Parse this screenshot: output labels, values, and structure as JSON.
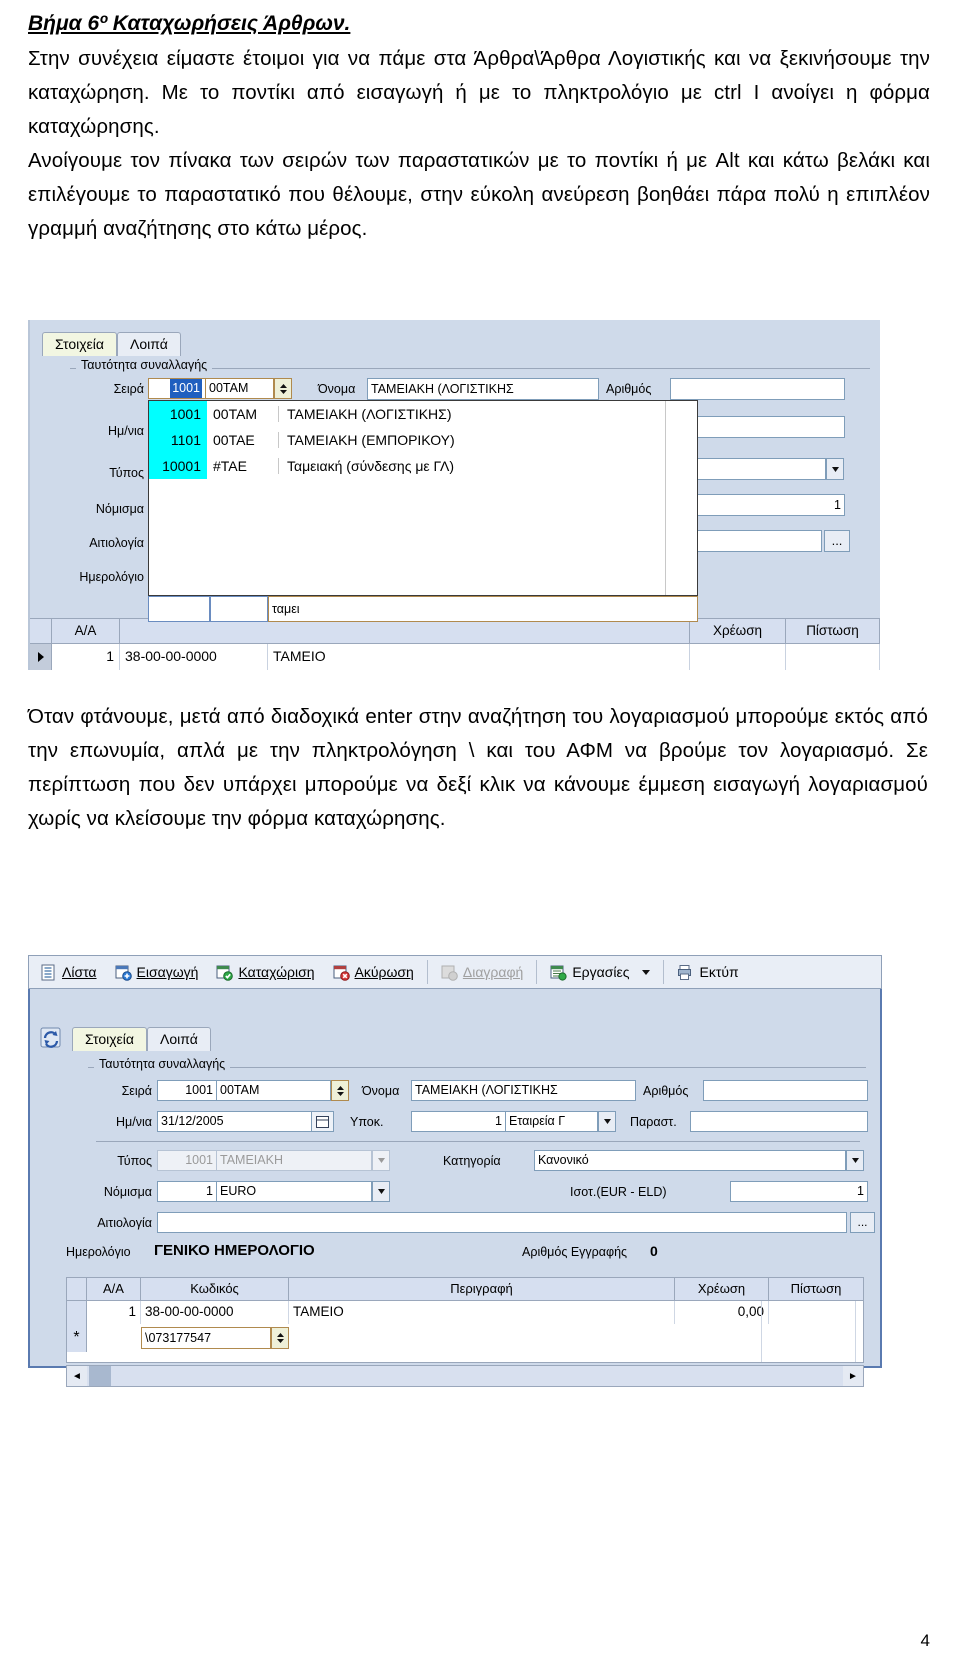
{
  "document": {
    "heading": "Βήμα 6º  Καταχωρήσεις Άρθρων.",
    "para1": "Στην συνέχεια είμαστε έτοιμοι για να πάμε στα Άρθρα\\Άρθρα Λογιστικής και να ξεκινήσουμε την καταχώρηση. Με το ποντίκι από εισαγωγή ή με το πληκτρολόγιο με ctrl I ανοίγει η φόρμα καταχώρησης.",
    "para2": "Ανοίγουμε τον πίνακα των σειρών των παραστατικών με το ποντίκι ή με Alt και κάτω βελάκι και επιλέγουμε το παραστατικό που θέλουμε, στην εύκολη ανεύρεση  βοηθάει πάρα πολύ η επιπλέον γραμμή αναζήτησης στο κάτω μέρος.",
    "para3": "Όταν φτάνουμε, μετά από διαδοχικά enter στην αναζήτηση του λογαριασμού μπορούμε εκτός από την επωνυμία, απλά με την πληκτρολόγηση \\ και του ΑΦΜ να βρούμε τον λογαριασμό. Σε περίπτωση που δεν υπάρχει μπορούμε να δεξί κλικ να κάνουμε έμμεση εισαγωγή λογαριασμού χωρίς να κλείσουμε την φόρμα καταχώρησης.",
    "page_number": "4"
  },
  "screenshot1": {
    "tabs": [
      {
        "label": "Στοιχεία",
        "active": true
      },
      {
        "label": "Λοιπά",
        "active": false
      }
    ],
    "group_title": "Ταυτότητα συναλλαγής",
    "labels": {
      "seira": "Σειρά",
      "onoma": "Όνομα",
      "arithmos": "Αριθμός",
      "imnia": "Ημ/νια",
      "typos": "Τύπος",
      "nomisma": "Νόμισμα",
      "aitiologia": "Αιτιολογία",
      "imerologio": "Ημερολόγιο"
    },
    "seira_code": "1001",
    "seira_abbr": "00TAM",
    "onoma_value": "ΤΑΜΕΙΑΚΗ (ΛΟΓΙΣΤΙΚΗΣ",
    "arithmos_value": "",
    "nomisma_rate": "1",
    "ellipsis_button": "...",
    "dropdown_items": [
      {
        "code": "1001",
        "abbr": "00TAM",
        "name": "ΤΑΜΕΙΑΚΗ (ΛΟΓΙΣΤΙΚΗΣ)"
      },
      {
        "code": "1101",
        "abbr": "00TAE",
        "name": "ΤΑΜΕΙΑΚΗ (ΕΜΠΟΡΙΚΟΥ)"
      },
      {
        "code": "10001",
        "abbr": "#TAE",
        "name": "Ταμειακή (σύνδεσης με ΓΛ)"
      }
    ],
    "search_value": "ταμει",
    "grid_headers": [
      "Α/Α",
      "Χρέωση",
      "Πίστωση"
    ],
    "grid_row": {
      "aa": "1",
      "code": "38-00-00-0000",
      "desc": "ΤΑΜΕΙΟ"
    }
  },
  "screenshot2": {
    "toolbar": [
      {
        "label": "Λίστα",
        "icon": "list-icon",
        "accel": "Λ",
        "disabled": false
      },
      {
        "label": "Εισαγωγή",
        "icon": "insert-icon",
        "accel": "Ε",
        "disabled": false
      },
      {
        "label": "Καταχώριση",
        "icon": "post-icon",
        "accel": "Κ",
        "disabled": false
      },
      {
        "label": "Ακύρωση",
        "icon": "cancel-icon",
        "accel": "Α",
        "disabled": false
      },
      {
        "label": "Διαγραφή",
        "icon": "delete-icon",
        "accel": "Δ",
        "disabled": true
      },
      {
        "label": "Εργασίες",
        "icon": "tasks-icon",
        "accel": "",
        "disabled": false
      },
      {
        "label": "Εκτύπ",
        "icon": "print-icon",
        "accel": "",
        "disabled": false
      }
    ],
    "tabs": [
      {
        "label": "Στοιχεία",
        "active": true
      },
      {
        "label": "Λοιπά",
        "active": false
      }
    ],
    "group_title": "Ταυτότητα συναλλαγής",
    "fields": {
      "seira_label": "Σειρά",
      "seira_code": "1001",
      "seira_abbr": "00TAM",
      "onoma_label": "Όνομα",
      "onoma_value": "ΤΑΜΕΙΑΚΗ (ΛΟΓΙΣΤΙΚΗΣ",
      "arithmos_label": "Αριθμός",
      "arithmos_value": "",
      "imnia_label": "Ημ/νια",
      "imnia_value": "31/12/2005",
      "ypok_label": "Υποκ.",
      "ypok_code": "1",
      "ypok_name": "Εταιρεία Γ",
      "parast_label": "Παραστ.",
      "parast_value": "",
      "typos_label": "Τύπος",
      "typos_code": "1001",
      "typos_name": "ΤΑΜΕΙΑΚΗ",
      "katigoria_label": "Κατηγορία",
      "katigoria_value": "Κανονικό",
      "nomisma_label": "Νόμισμα",
      "nomisma_code": "1",
      "nomisma_name": "EURO",
      "isot_label": "Ισοτ.(EUR -  ELD)",
      "isot_value": "1",
      "aitiologia_label": "Αιτιολογία",
      "aitiologia_value": "",
      "ellipsis_button": "...",
      "imerologio_label": "Ημερολόγιο",
      "imerologio_value": "ΓΕΝΙΚΟ ΗΜΕΡΟΛΟΓΙΟ",
      "arithmos_eggrafis_label": "Αριθμός Εγγραφής",
      "arithmos_eggrafis_value": "0"
    },
    "grid_headers": [
      "Α/Α",
      "Κωδικός",
      "Περιγραφή",
      "Χρέωση",
      "Πίστωση"
    ],
    "grid_rows": [
      {
        "aa": "1",
        "code": "38-00-00-0000",
        "desc": "ΤΑΜΕΙΟ",
        "xreosi": "0,00",
        "pistosi": ""
      }
    ],
    "row_marker": "*",
    "afm_edit_value": "\\073177547",
    "scroll_left": "◄",
    "scroll_right": "►"
  },
  "colors": {
    "panel": "#cfdaea",
    "highlight": "#00ffff",
    "selection": "#1f5fbf",
    "tab_active": "#f2f6e2",
    "field_border": "#7f9db9",
    "spinner": "#eef0d8"
  }
}
